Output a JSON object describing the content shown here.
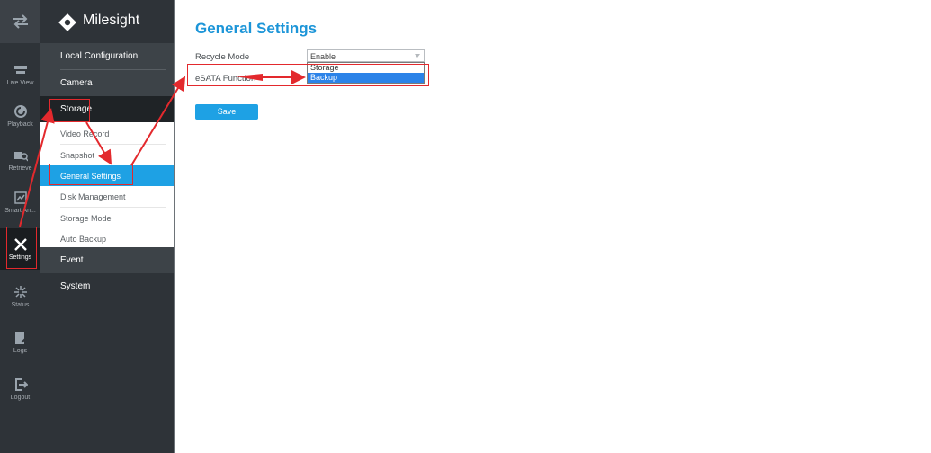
{
  "brand": {
    "name": "Milesight"
  },
  "rail": {
    "items": [
      {
        "label": "",
        "icon": "swap-arrows-icon"
      },
      {
        "label": "Live View",
        "icon": "live-view-icon"
      },
      {
        "label": "Playback",
        "icon": "playback-icon"
      },
      {
        "label": "Retrieve",
        "icon": "retrieve-icon"
      },
      {
        "label": "Smart An...",
        "icon": "smart-analysis-icon"
      },
      {
        "label": "Settings",
        "icon": "settings-wrench-icon"
      },
      {
        "label": "Status",
        "icon": "status-icon"
      },
      {
        "label": "Logs",
        "icon": "logs-icon"
      },
      {
        "label": "Logout",
        "icon": "logout-icon"
      }
    ]
  },
  "menu": {
    "local_configuration": "Local Configuration",
    "camera": "Camera",
    "storage": "Storage",
    "storage_items": [
      "Video Record",
      "Snapshot",
      "General Settings",
      "Disk Management",
      "Storage Mode",
      "Auto Backup"
    ],
    "event": "Event",
    "system": "System"
  },
  "page": {
    "title": "General Settings",
    "recycle_mode_label": "Recycle Mode",
    "recycle_mode_value": "Enable",
    "esata_label": "eSATA Function",
    "esata_options": [
      "Storage",
      "Backup"
    ],
    "esata_highlighted": "Backup",
    "save_label": "Save"
  },
  "colors": {
    "accent": "#1ea1e4",
    "annotation": "#e3292d",
    "rail_bg": "#2e3338"
  }
}
